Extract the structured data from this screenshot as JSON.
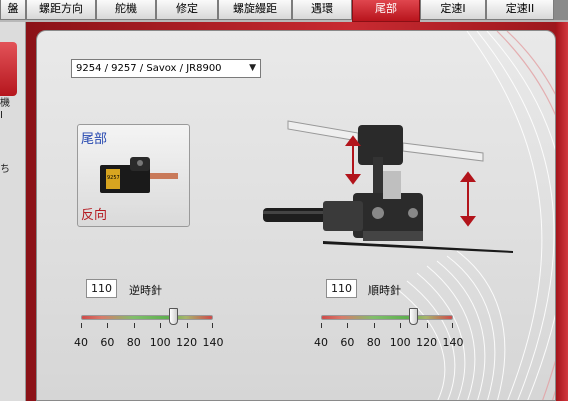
{
  "tabs": [
    {
      "label": "盤",
      "active": false
    },
    {
      "label": "螺距方向",
      "active": false
    },
    {
      "label": "舵機",
      "active": false
    },
    {
      "label": "修定",
      "active": false
    },
    {
      "label": "螺旋縵距",
      "active": false
    },
    {
      "label": "遇環",
      "active": false
    },
    {
      "label": "尾部",
      "active": true
    },
    {
      "label": "定速I",
      "active": false
    },
    {
      "label": "定速II",
      "active": false
    }
  ],
  "left_panel": {
    "fragments": [
      "機",
      "I",
      "ち"
    ]
  },
  "servo_select": {
    "value": "9254 / 9257 / Savox / JR8900",
    "options_visible": [
      "9254 / 9257 / Savox / JR8900"
    ]
  },
  "servo_card": {
    "title": "尾部",
    "direction": "反向",
    "servo_text": "9257"
  },
  "travel_left": {
    "value": "110",
    "label": "逆時針",
    "slider_value": 110,
    "scale_min": 40,
    "scale_max": 140,
    "tick_labels": [
      "40",
      "60",
      "80",
      "100",
      "120",
      "140"
    ]
  },
  "travel_right": {
    "value": "110",
    "label": "順時針",
    "slider_value": 110,
    "scale_min": 40,
    "scale_max": 140,
    "tick_labels": [
      "40",
      "60",
      "80",
      "100",
      "120",
      "140"
    ]
  },
  "colors": {
    "accent": "#c0161d",
    "panel": "#e2e2e2",
    "title_blue": "#2648b0"
  }
}
